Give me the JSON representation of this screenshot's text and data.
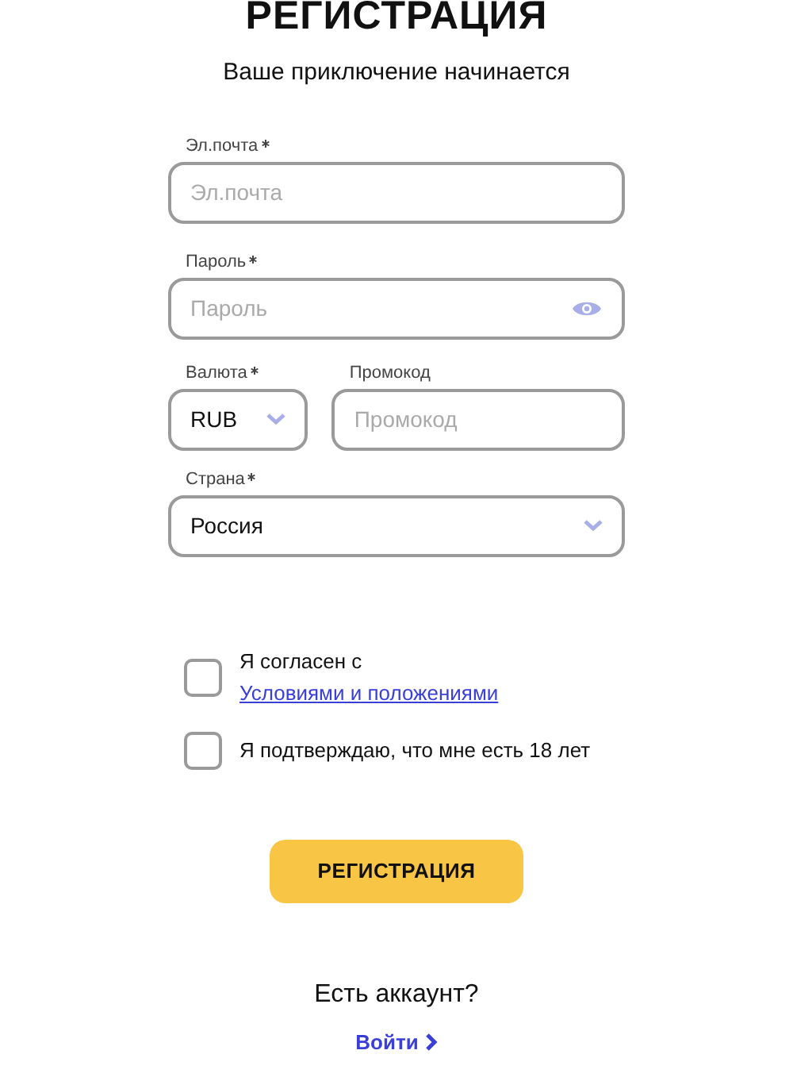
{
  "title": "РЕГИСТРАЦИЯ",
  "subtitle": "Ваше приключение начинается",
  "fields": [
    {
      "label": "Эл.почта",
      "required": true,
      "placeholder": "Эл.почта",
      "kind": "text"
    },
    {
      "label": "Пароль",
      "required": true,
      "placeholder": "Пароль",
      "kind": "password"
    }
  ],
  "currency": {
    "label": "Валюта",
    "required": true,
    "value": "RUB"
  },
  "promo": {
    "label": "Промокод",
    "required": false,
    "placeholder": "Промокод"
  },
  "country": {
    "label": "Страна",
    "required": true,
    "value": "Россия"
  },
  "checkboxes": [
    {
      "text": "Я согласен с ",
      "link": "Условиями и положениями",
      "checked": false
    },
    {
      "text": "Я подтверждаю, что мне есть 18 лет",
      "checked": false
    }
  ],
  "submit": "РЕГИСТРАЦИЯ",
  "account_prompt": "Есть аккаунт?",
  "login_link": "Войти"
}
